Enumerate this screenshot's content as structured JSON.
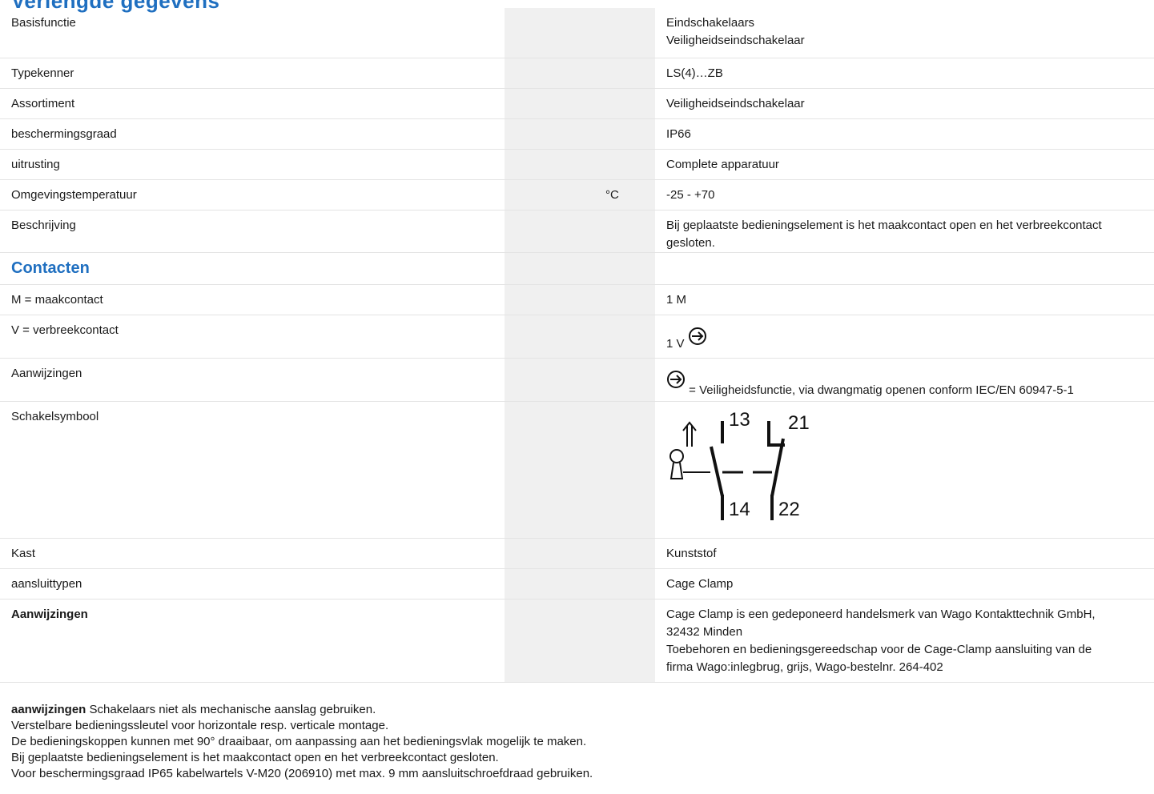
{
  "header": {
    "title_fragment": "Verlengde gegevens"
  },
  "rows": [
    {
      "label": "Basisfunctie",
      "unit": "",
      "value_lines": [
        "Eindschakelaars",
        "Veiligheidseindschakelaar"
      ]
    },
    {
      "label": "Typekenner",
      "unit": "",
      "value": "LS(4)…ZB"
    },
    {
      "label": "Assortiment",
      "unit": "",
      "value": "Veiligheidseindschakelaar"
    },
    {
      "label": "beschermingsgraad",
      "unit": "",
      "value": "IP66"
    },
    {
      "label": "uitrusting",
      "unit": "",
      "value": "Complete apparatuur"
    },
    {
      "label": "Omgevingstemperatuur",
      "unit": "°C",
      "value": "-25 - +70"
    },
    {
      "label": "Beschrijving",
      "unit": "",
      "value_lines": [
        "Bij geplaatste bedieningselement is het maakcontact open en het verbreekcontact",
        "gesloten."
      ]
    }
  ],
  "contacts": {
    "title": "Contacten",
    "make_label": "M = maakcontact",
    "make_value": "1 M",
    "break_label": "V = verbreekcontact",
    "break_value": "1 V",
    "notes_label": "Aanwijzingen",
    "notes_value": "= Veiligheidsfunctie, via dwangmatig openen conform IEC/EN 60947-5-1",
    "safety_icon": "positive-opening-icon"
  },
  "symbol": {
    "label": "Schakelsymbool",
    "terminals": [
      "13",
      "14",
      "21",
      "22"
    ]
  },
  "rows_after": [
    {
      "label": "Kast",
      "value": "Kunststof"
    },
    {
      "label": "aansluittypen",
      "value": "Cage Clamp"
    }
  ],
  "aanwijzingen": {
    "label": "Aanwijzingen",
    "value_lines": [
      "Cage Clamp is een gedeponeerd handelsmerk van Wago Kontakttechnik GmbH,",
      "32432 Minden",
      "Toebehoren en bedieningsgereedschap voor de Cage-Clamp aansluiting van de",
      "firma Wago:inlegbrug, grijs, Wago-bestelnr. 264-402"
    ]
  },
  "footer_notes": {
    "bold_prefix": "aanwijzingen",
    "first_line": " Schakelaars niet als mechanische aanslag gebruiken.",
    "lines": [
      "Verstelbare bedieningssleutel voor horizontale resp. verticale montage.",
      "De bedieningskoppen kunnen met 90° draaibaar, om aanpassing aan het bedieningsvlak mogelijk te maken.",
      "Bij geplaatste bedieningselement is het maakcontact open en het verbreekcontact gesloten.",
      "Voor beschermingsgraad IP65 kabelwartels V-M20 (206910) met max. 9 mm aansluitschroefdraad gebruiken."
    ]
  }
}
